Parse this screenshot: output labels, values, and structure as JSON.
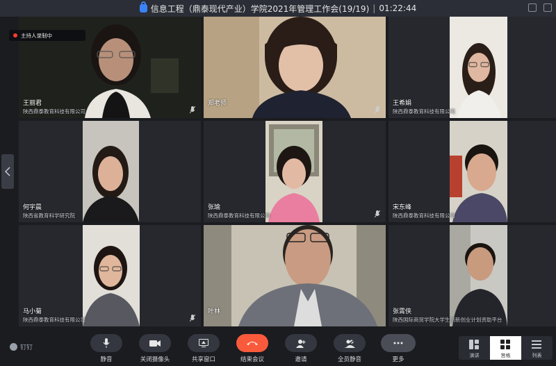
{
  "window": {
    "title": "信息工程（鼎泰现代产业）学院2021年管理工作会(19/19)",
    "separator": "|",
    "elapsed": "01:22:44"
  },
  "recording_label": "主持人录制中",
  "participants": [
    {
      "name": "王丽君",
      "org": "陕西鼎泰教育科技有限公司"
    },
    {
      "name": "郑老师",
      "org": ""
    },
    {
      "name": "王希娟",
      "org": "陕西鼎泰教育科技有限公司"
    },
    {
      "name": "何宇晨",
      "org": "陕西省教育科学研究院"
    },
    {
      "name": "张瑜",
      "org": "陕西鼎泰教育科技有限公司"
    },
    {
      "name": "宋东峰",
      "org": "陕西鼎泰教育科技有限公司"
    },
    {
      "name": "马小菊",
      "org": "陕西鼎泰教育科技有限公司"
    },
    {
      "name": "叶林",
      "org": ""
    },
    {
      "name": "张霄侠",
      "org": "陕西国际商贸学院大学生创新创业计划资助平台"
    }
  ],
  "brand": "钉钉",
  "controls": {
    "mute": "静音",
    "camera_off": "关闭摄像头",
    "share_window": "共享窗口",
    "end_meeting": "结束会议",
    "invite": "邀请",
    "mute_all": "全员静音",
    "more": "更多"
  },
  "view_modes": {
    "speaker": "演讲",
    "gallery": "宫格",
    "list": "列表",
    "active": "gallery"
  },
  "colors": {
    "end_button": "#fa5a3c",
    "recording_dot": "#ff3b30",
    "lock": "#3b82f6"
  }
}
